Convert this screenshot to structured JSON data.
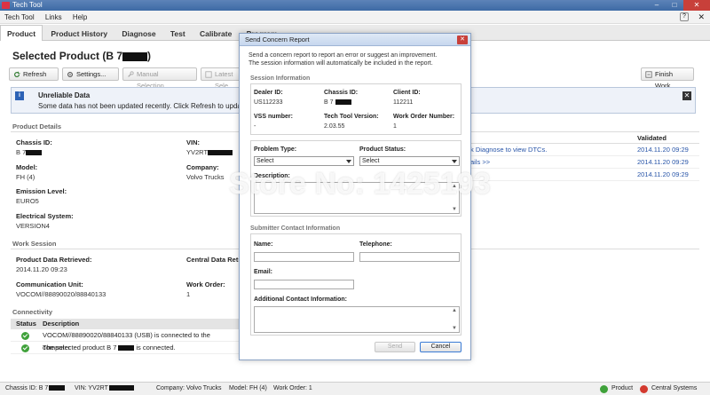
{
  "window": {
    "title": "Tech Tool"
  },
  "menu": {
    "items": [
      "Tech Tool",
      "Links",
      "Help"
    ]
  },
  "tabs": [
    "Product",
    "Product History",
    "Diagnose",
    "Test",
    "Calibrate",
    "Program"
  ],
  "page": {
    "title": "Selected Product (B 7",
    "title_suffix": ")"
  },
  "toolbar": {
    "refresh": "Refresh",
    "settings": "Settings...",
    "manual_selection": "Manual Selection...",
    "latest_selection": "Latest Sele",
    "finish_work": "Finish Work"
  },
  "warning": {
    "title": "Unreliable Data",
    "text": "Some data has not been updated recently. Click Refresh to update d"
  },
  "product_details": {
    "heading": "Product Details",
    "chassis_id_label": "Chassis ID:",
    "chassis_id_value": "B 7",
    "vin_label": "VIN:",
    "vin_value": "YV2RT",
    "model_label": "Model:",
    "model_value": "FH (4)",
    "company_label": "Company:",
    "company_value": "Volvo Trucks",
    "emission_label": "Emission Level:",
    "emission_value": "EURO5",
    "electrical_label": "Electrical System:",
    "electrical_value": "VERSION4"
  },
  "work_session": {
    "heading": "Work Session",
    "retrieved_label": "Product Data Retrieved:",
    "retrieved_value": "2014.11.20 09:23",
    "central_label": "Central Data Retri",
    "comm_label": "Communication Unit:",
    "comm_value": "VOCOM//88890020/88840133",
    "work_order_label": "Work Order:",
    "work_order_value": "1"
  },
  "connectivity": {
    "heading": "Connectivity",
    "col_status": "Status",
    "col_description": "Description",
    "rows": [
      "VOCOM//88890020/88840133 (USB) is connected to the computer",
      "The selected product B 7"
    ],
    "row2_suffix": "is connected."
  },
  "right_panel": {
    "header": "Validated",
    "rows": [
      {
        "desc": "k Diagnose to view DTCs.",
        "time": "2014.11.20 09:29"
      },
      {
        "desc": "ails >>",
        "time": "2014.11.20 09:29"
      },
      {
        "desc": "",
        "time": "2014.11.20 09:29"
      }
    ]
  },
  "statusbar": {
    "chassis": "Chassis ID: B 7",
    "vin": "VIN: YV2RT",
    "company": "Company: Volvo Trucks",
    "model": "Model: FH (4)",
    "work_order": "Work Order: 1",
    "product": "Product",
    "central": "Central Systems"
  },
  "watermark": "Store No: 1425193",
  "dialog": {
    "title": "Send Concern Report",
    "intro_line1": "Send a concern report to report an error or suggest an improvement.",
    "intro_line2": "The session information will automatically be included in the report.",
    "session_heading": "Session Information",
    "dealer_id_label": "Dealer ID:",
    "dealer_id_value": "US112233",
    "chassis_label": "Chassis ID:",
    "chassis_value": "B 7",
    "client_label": "Client ID:",
    "client_value": "112211",
    "vss_label": "VSS number:",
    "vss_value": "-",
    "version_label": "Tech Tool Version:",
    "version_value": "2.03.55",
    "work_order_label": "Work Order Number:",
    "work_order_value": "1",
    "problem_type_label": "Problem Type:",
    "problem_type_value": "Select",
    "product_status_label": "Product Status:",
    "product_status_value": "Select",
    "description_label": "Description:",
    "contact_heading": "Submitter Contact Information",
    "name_label": "Name:",
    "telephone_label": "Telephone:",
    "email_label": "Email:",
    "additional_label": "Additional Contact Information:",
    "send": "Send",
    "cancel": "Cancel"
  }
}
